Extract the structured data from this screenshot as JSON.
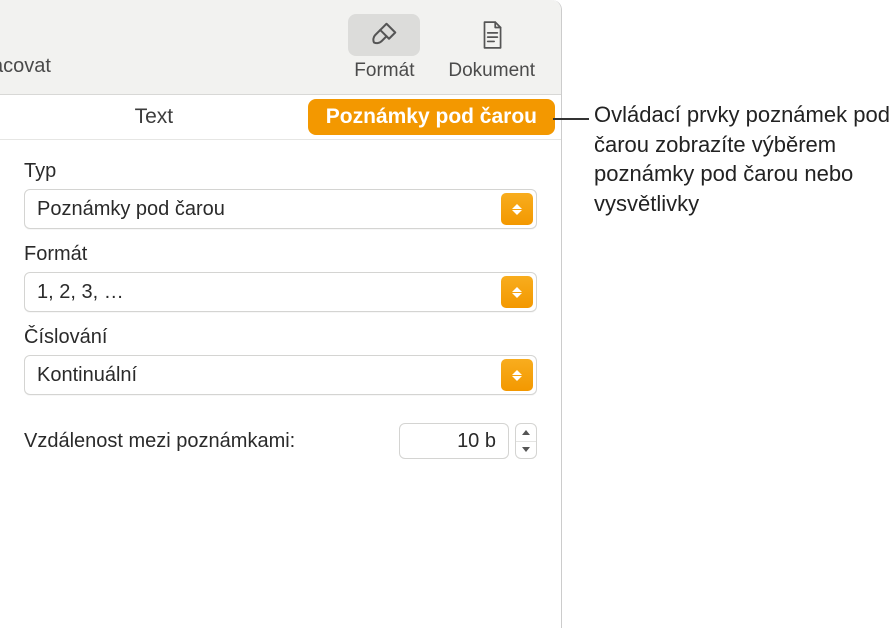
{
  "toolbar": {
    "left_truncated": "acovat",
    "format_label": "Formát",
    "document_label": "Dokument"
  },
  "tabs": {
    "text": "Text",
    "footnotes": "Poznámky pod čarou"
  },
  "fields": {
    "type_label": "Typ",
    "type_value": "Poznámky pod čarou",
    "format_label": "Formát",
    "format_value": "1, 2, 3, …",
    "numbering_label": "Číslování",
    "numbering_value": "Kontinuální",
    "spacing_label": "Vzdálenost mezi poznámkami:",
    "spacing_value": "10 b"
  },
  "callout": "Ovládací prvky poznámek pod čarou zobrazíte výběrem poznámky pod čarou nebo vysvětlivky"
}
